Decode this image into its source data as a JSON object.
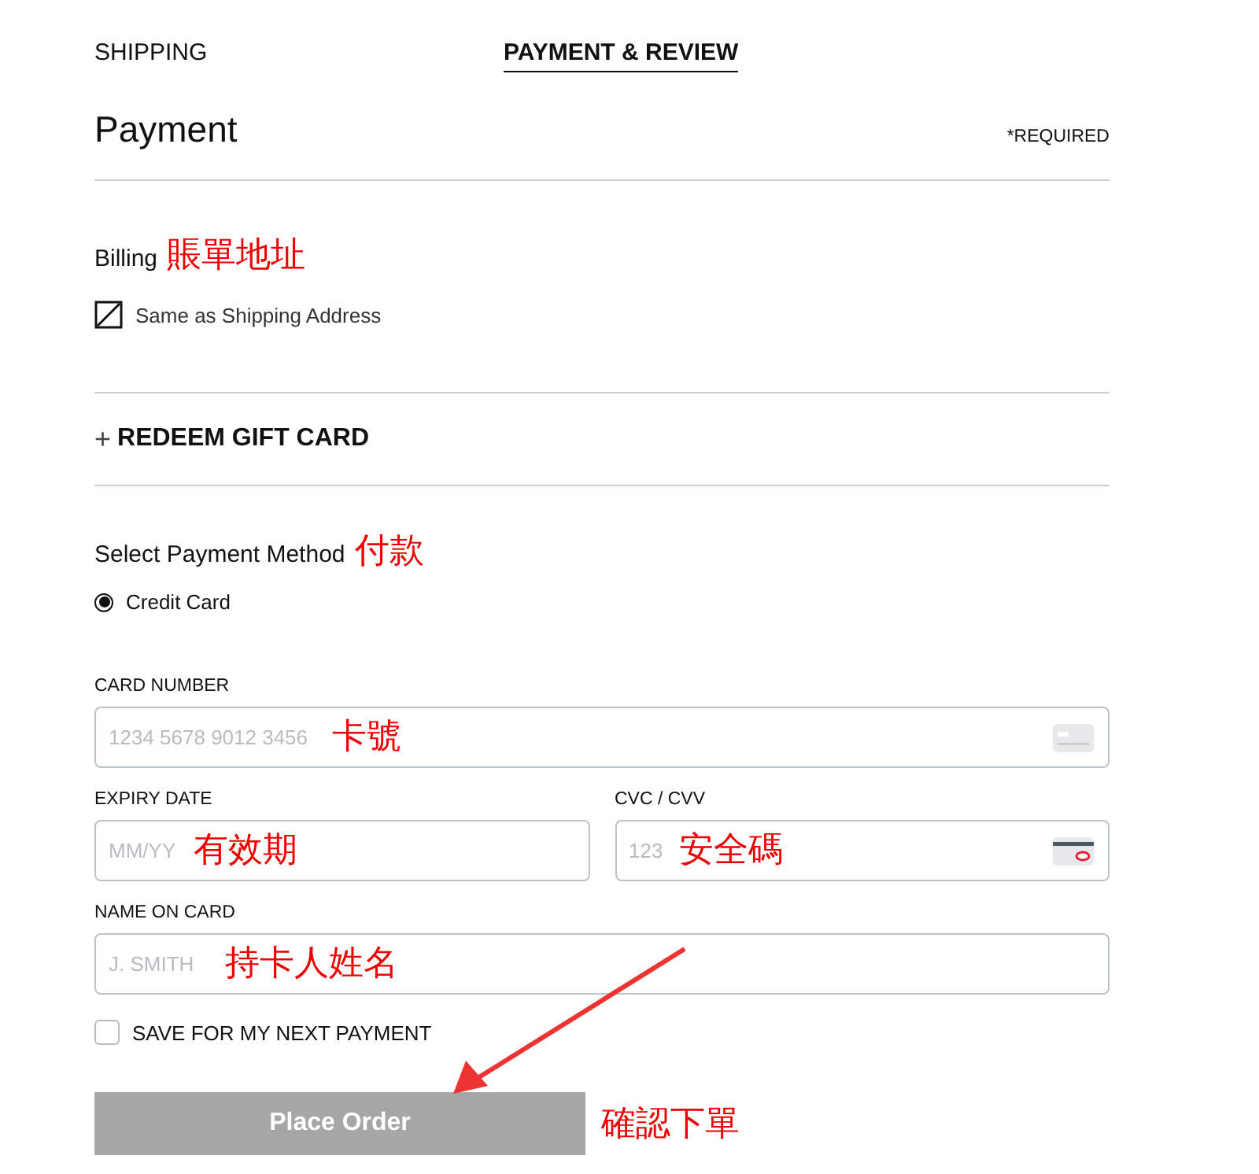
{
  "steps": [
    {
      "label": "SHIPPING",
      "selected": false
    },
    {
      "label": "PAYMENT & REVIEW",
      "selected": true
    }
  ],
  "heading": "Payment",
  "required_note": "*REQUIRED",
  "billing": {
    "title": "Billing",
    "note": "賬單地址",
    "same_as_shipping": {
      "label": "Same as Shipping Address",
      "checked": false,
      "disabled": true
    }
  },
  "gift_card": {
    "icon": "+",
    "label": "REDEEM GIFT CARD"
  },
  "payment_method": {
    "title": "Select Payment Method",
    "note": "付款",
    "options": [
      {
        "label": "Credit Card",
        "selected": true
      }
    ]
  },
  "fields": [
    {
      "label": "CARD NUMBER",
      "placeholder": "1234 5678 9012 3456",
      "note": "卡號",
      "kind": "card"
    },
    {
      "label": "EXPIRY DATE",
      "placeholder": "MM/YY",
      "note": "有效期",
      "kind": "expiry"
    },
    {
      "label": "CVC / CVV",
      "placeholder": "123",
      "note": "安全碼",
      "kind": "cvc"
    },
    {
      "label": "NAME ON CARD",
      "placeholder": "J. SMITH",
      "note": "持卡人姓名",
      "kind": "name"
    }
  ],
  "save_payment": {
    "label": "SAVE FOR MY NEXT PAYMENT",
    "checked": false
  },
  "place_order": {
    "label": "Place Order",
    "disabled": true,
    "note": "確認下單"
  }
}
